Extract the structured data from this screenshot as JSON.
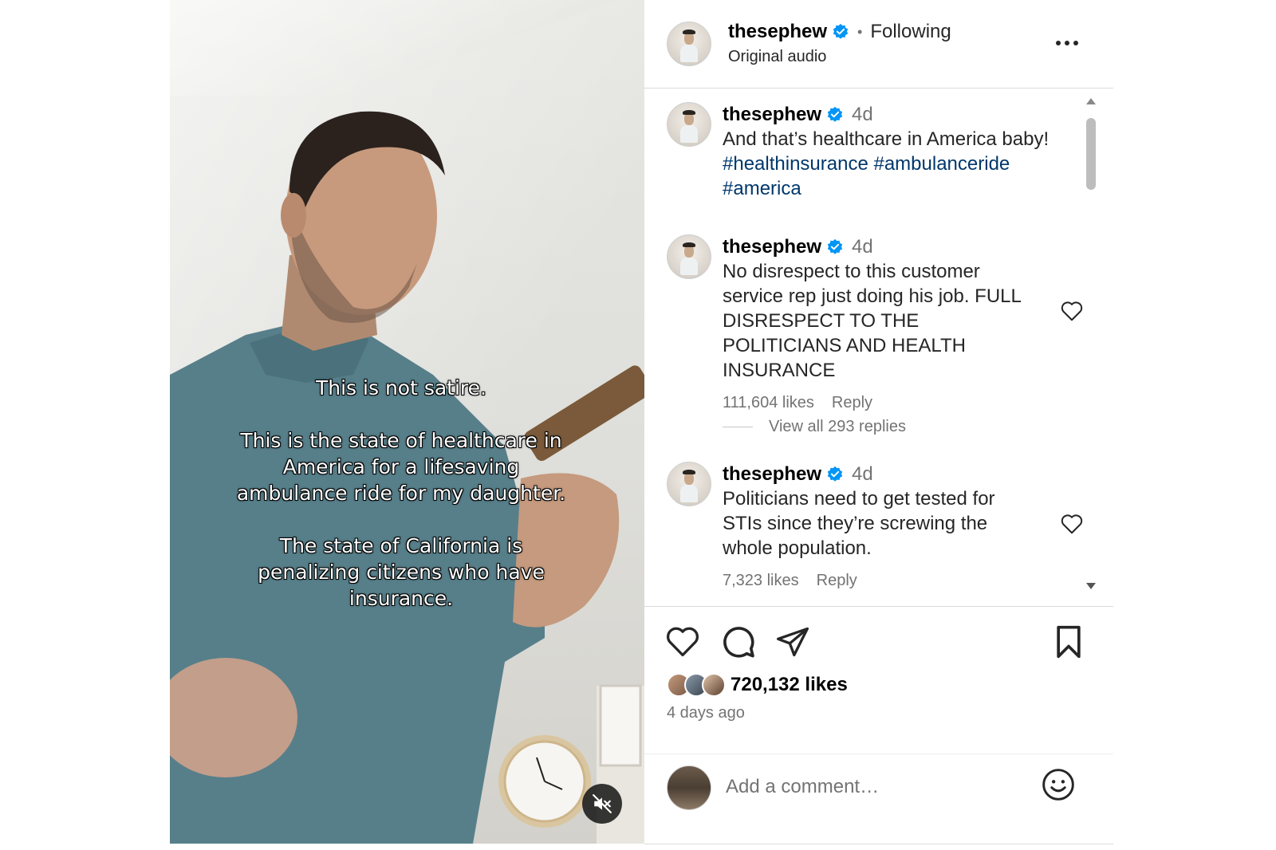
{
  "post": {
    "username": "thesephew",
    "following_label": "Following",
    "audio_label": "Original audio",
    "video_captions": [
      "This is not satire.",
      "This is the state of healthcare in America for a lifesaving ambulance ride for my daughter.",
      "The state of California is penalizing citizens who have insurance."
    ]
  },
  "caption": {
    "username": "thesephew",
    "time": "4d",
    "text": "And that’s healthcare in America baby!",
    "hashtags": [
      "#healthinsurance",
      "#ambulanceride",
      "#america"
    ]
  },
  "comments": [
    {
      "username": "thesephew",
      "time": "4d",
      "text": "No disrespect to this customer service rep just doing his job. FULL DISRESPECT TO THE POLITICIANS AND HEALTH INSURANCE",
      "likes": "111,604 likes",
      "reply": "Reply"
    },
    {
      "username": "thesephew",
      "time": "4d",
      "text": "Politicians need to get tested for STIs since they’re screwing the whole population.",
      "likes": "7,323 likes",
      "reply": "Reply"
    }
  ],
  "view_replies": "View all 293 replies",
  "likes_total": "720,132 likes",
  "posted_ago": "4 days ago",
  "add_comment_placeholder": "Add a comment…",
  "icons": {
    "verified": "verified-badge-icon",
    "more": "more-options-icon",
    "like": "heart-icon",
    "comment": "comment-icon",
    "share": "share-icon",
    "save": "bookmark-icon",
    "emoji": "emoji-icon",
    "mute": "volume-muted-icon"
  },
  "colors": {
    "verified_blue": "#0095f6",
    "hashtag": "#00376b",
    "secondary_text": "#737373",
    "divider": "#dbdbdb"
  }
}
